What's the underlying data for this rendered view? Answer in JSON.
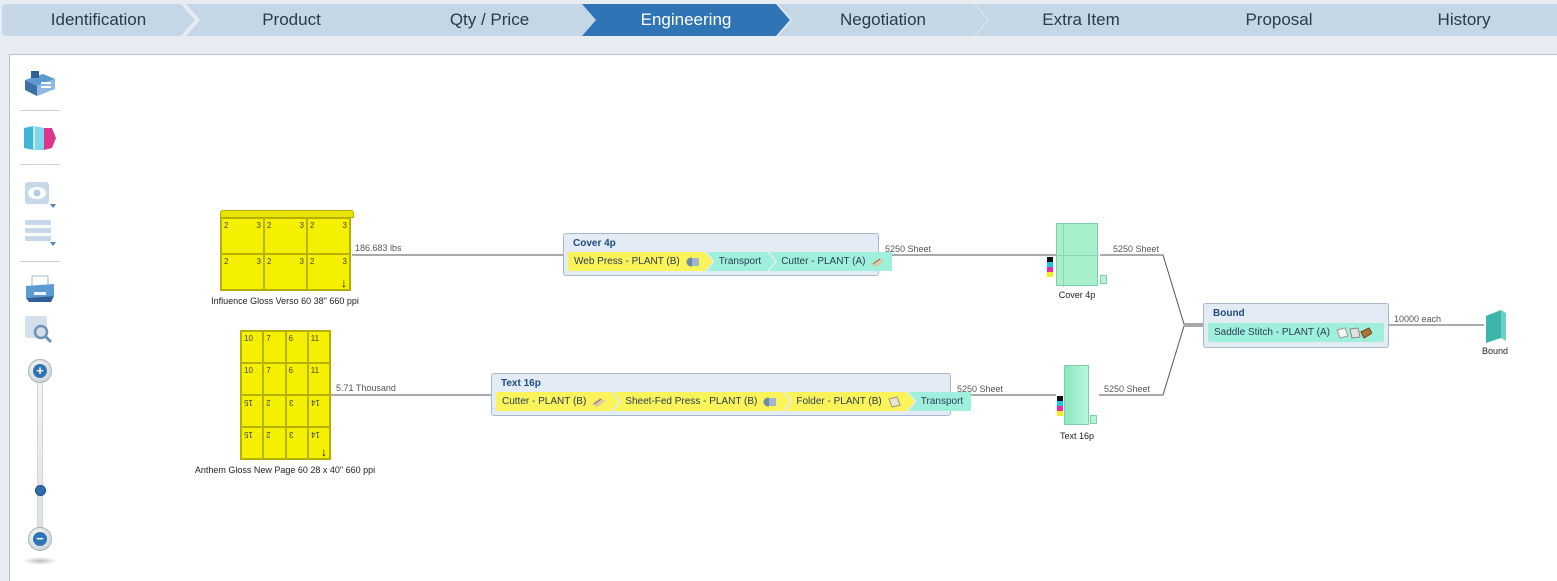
{
  "tabs": [
    {
      "label": "Identification"
    },
    {
      "label": "Product"
    },
    {
      "label": "Qty / Price"
    },
    {
      "label": "Engineering",
      "active": true
    },
    {
      "label": "Negotiation"
    },
    {
      "label": "Extra Item"
    },
    {
      "label": "Proposal"
    },
    {
      "label": "History"
    }
  ],
  "toolbar": {
    "tools": [
      "building-icon",
      "book-icon",
      "eye-view-icon",
      "layers-icon",
      "printer-icon",
      "zoom-magnifier-icon"
    ],
    "zoom_in": "+",
    "zoom_out": "−",
    "zoom_level": 0.2
  },
  "flow": {
    "stock": [
      {
        "label": "Influence Gloss Verso 60 38\" 660 ppi",
        "edge": "186.683 lbs",
        "cells": [
          "2",
          "3",
          "2",
          "3",
          "2",
          "3",
          "2",
          "3",
          "2",
          "3",
          "2",
          "3"
        ]
      },
      {
        "label": "Anthem Gloss New Page 60 28 x 40\" 660 ppi",
        "edge": "5.71 Thousand",
        "cells": [
          "10",
          "7",
          "6",
          "11",
          "10",
          "7",
          "6",
          "11",
          "15",
          "2",
          "3",
          "14",
          "15",
          "2",
          "3",
          "14"
        ]
      }
    ],
    "processes": [
      {
        "title": "Cover 4p",
        "edge": "5250 Sheet",
        "steps": [
          "Web Press - PLANT (B)",
          "Transport",
          "Cutter - PLANT (A)"
        ]
      },
      {
        "title": "Text 16p",
        "edge": "5250 Sheet",
        "steps": [
          "Cutter - PLANT (B)",
          "Sheet-Fed Press - PLANT (B)",
          "Folder - PLANT (B)",
          "Transport"
        ]
      }
    ],
    "parts": [
      {
        "label": "Cover 4p",
        "edge": "5250 Sheet"
      },
      {
        "label": "Text 16p",
        "edge": "5250 Sheet"
      }
    ],
    "bind": {
      "title": "Bound",
      "step": "Saddle Stitch - PLANT (A)",
      "edge": "10000 each"
    },
    "output": {
      "label": "Bound"
    }
  },
  "colors": {
    "accent": "#2f74b5",
    "press_step": "#faf35a",
    "logistics_step": "#9ef0dc",
    "stock": "#f4f000",
    "part": "#a8f0cc"
  }
}
